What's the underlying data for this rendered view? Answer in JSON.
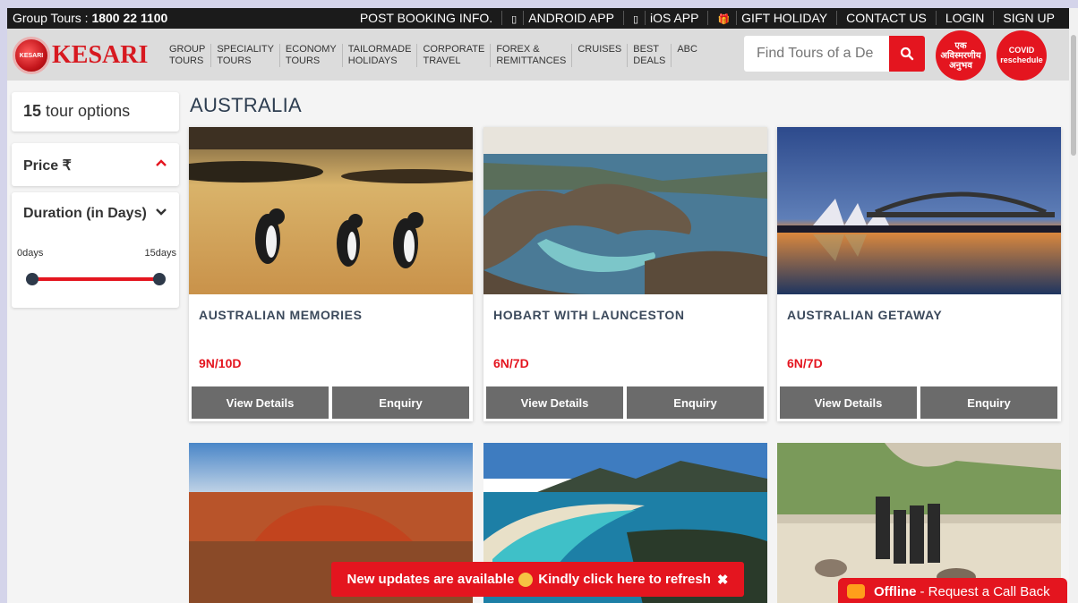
{
  "topbar": {
    "phone_label": "Group Tours : ",
    "phone_number": "1800 22 1100",
    "links": [
      {
        "label": "POST BOOKING INFO.",
        "icon": ""
      },
      {
        "label": "ANDROID APP",
        "icon": "mobile-icon"
      },
      {
        "label": "iOS APP",
        "icon": "mobile-icon"
      },
      {
        "label": "GIFT HOLIDAY",
        "icon": "gift-icon"
      },
      {
        "label": "CONTACT US",
        "icon": ""
      },
      {
        "label": "LOGIN",
        "icon": ""
      },
      {
        "label": "SIGN UP",
        "icon": ""
      }
    ]
  },
  "brand": {
    "logo_text": "KESARI",
    "globe_text": "KESARI"
  },
  "nav": {
    "items": [
      "GROUP\nTOURS",
      "SPECIALITY\nTOURS",
      "ECONOMY\nTOURS",
      "TAILORMADE\nHOLIDAYS",
      "CORPORATE\nTRAVEL",
      "FOREX &\nREMITTANCES",
      "CRUISES",
      "BEST\nDEALS",
      "ABC"
    ],
    "search_placeholder": "Find Tours of a De",
    "badge1": "एक अविस्मरणीय अनुभव",
    "badge2": "COVID reschedule"
  },
  "sidebar": {
    "count": "15",
    "count_label": " tour options",
    "price_label": "Price ₹",
    "duration_label": "Duration (in Days)",
    "range_min": "0days",
    "range_max": "15days"
  },
  "heading": "AUSTRALIA",
  "tours": [
    {
      "name": "AUSTRALIAN MEMORIES",
      "duration": "9N/10D",
      "view_label": "View Details",
      "enquiry_label": "Enquiry"
    },
    {
      "name": "HOBART WITH LAUNCESTON",
      "duration": "6N/7D",
      "view_label": "View Details",
      "enquiry_label": "Enquiry"
    },
    {
      "name": "AUSTRALIAN GETAWAY",
      "duration": "6N/7D",
      "view_label": "View Details",
      "enquiry_label": "Enquiry"
    }
  ],
  "toast": {
    "text1": "New updates are available",
    "text2": "Kindly click here to refresh",
    "close": "✖"
  },
  "callback": {
    "status": "Offline",
    "text": "- Request a Call Back"
  },
  "colors": {
    "accent": "#e4151f",
    "dark": "#1b1b1b",
    "heading": "#2d3d50",
    "button": "#6b6b6b"
  }
}
